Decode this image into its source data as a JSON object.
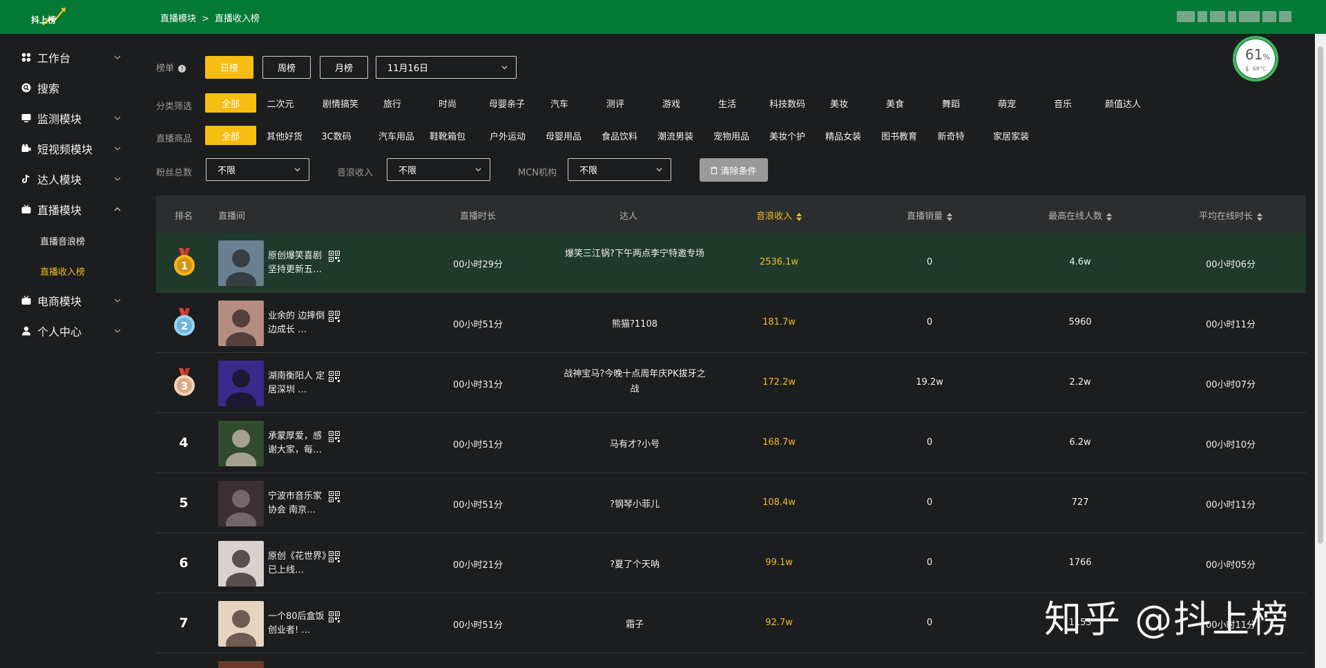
{
  "header": {
    "logo_text": "抖上榜",
    "breadcrumb": [
      "直播模块",
      "直播收入榜"
    ],
    "breadcrumb_sep": ">"
  },
  "sidebar": {
    "items": [
      {
        "label": "工作台",
        "icon": "grid-icon",
        "has_chevron": true,
        "expanded": false
      },
      {
        "label": "搜索",
        "icon": "search-icon",
        "has_chevron": false
      },
      {
        "label": "监测模块",
        "icon": "monitor-icon",
        "has_chevron": true,
        "expanded": false
      },
      {
        "label": "短视频模块",
        "icon": "video-icon",
        "has_chevron": true,
        "expanded": false
      },
      {
        "label": "达人模块",
        "icon": "tiktok-icon",
        "has_chevron": true,
        "expanded": false
      },
      {
        "label": "直播模块",
        "icon": "live-icon",
        "has_chevron": true,
        "expanded": true
      },
      {
        "label": "电商模块",
        "icon": "cart-icon",
        "has_chevron": true,
        "expanded": false
      },
      {
        "label": "个人中心",
        "icon": "user-icon",
        "has_chevron": true,
        "expanded": false
      }
    ],
    "live_sub": [
      "直播音浪榜",
      "直播收入榜"
    ],
    "active_sub": "直播收入榜"
  },
  "filters": {
    "board_label": "榜单",
    "board_tabs": [
      "日榜",
      "周榜",
      "月榜"
    ],
    "board_active": "日榜",
    "date_value": "11月16日",
    "category_label": "分类筛选",
    "categories": [
      "全部",
      "二次元",
      "剧情搞笑",
      "旅行",
      "时尚",
      "母婴亲子",
      "汽车",
      "测评",
      "游戏",
      "生活",
      "科技数码",
      "美妆",
      "美食",
      "舞蹈",
      "萌宠",
      "音乐",
      "颜值达人"
    ],
    "goods_label": "直播商品",
    "goods": [
      "全部",
      "其他好货",
      "3C数码",
      "汽车用品",
      "鞋靴箱包",
      "户外运动",
      "母婴用品",
      "食品饮料",
      "潮流男装",
      "宠物用品",
      "美妆个护",
      "精品女装",
      "图书教育",
      "新奇特",
      "家居家装"
    ],
    "fans_label": "粉丝总数",
    "fans_value": "不限",
    "income_label": "音浪收入",
    "income_value": "不限",
    "mcn_label": "MCN机构",
    "mcn_value": "不限",
    "clear_label": "清除条件"
  },
  "gauge": {
    "value": "61",
    "unit": "%",
    "temp": "68°C"
  },
  "table": {
    "headers": [
      "排名",
      "直播间",
      "直播时长",
      "达人",
      "音浪收入",
      "直播销量",
      "最高在线人数",
      "平均在线时长"
    ],
    "rows": [
      {
        "rank": "1",
        "room": "原创爆笑喜剧 坚持更新五…",
        "duration": "00小时29分",
        "talent": "爆笑三江锅?下午两点李宁特邀专场",
        "income": "2536.1w",
        "sales": "0",
        "max_online": "4.6w",
        "avg_online": "00小时06分"
      },
      {
        "rank": "2",
        "room": "业余的 边摔倒边成长 …",
        "duration": "00小时51分",
        "talent": "熊猫?1108",
        "income": "181.7w",
        "sales": "0",
        "max_online": "5960",
        "avg_online": "00小时11分"
      },
      {
        "rank": "3",
        "room": "湖南衡阳人 定居深圳 …",
        "duration": "00小时31分",
        "talent": "战神宝马?今晚十点周年庆PK拔牙之战",
        "income": "172.2w",
        "sales": "19.2w",
        "max_online": "2.2w",
        "avg_online": "00小时07分"
      },
      {
        "rank": "4",
        "room": "承蒙厚爱，感谢大家，每…",
        "duration": "00小时51分",
        "talent": "马有才?小号",
        "income": "168.7w",
        "sales": "0",
        "max_online": "6.2w",
        "avg_online": "00小时10分"
      },
      {
        "rank": "5",
        "room": "宁波市音乐家协会 南京…",
        "duration": "00小时51分",
        "talent": "?钢琴小菲儿",
        "income": "108.4w",
        "sales": "0",
        "max_online": "727",
        "avg_online": "00小时11分"
      },
      {
        "rank": "6",
        "room": "原创《花世界》已上线…",
        "duration": "00小时21分",
        "talent": "?夏了个天呐",
        "income": "99.1w",
        "sales": "0",
        "max_online": "1766",
        "avg_online": "00小时05分"
      },
      {
        "rank": "7",
        "room": "一个80后盒饭创业者! …",
        "duration": "00小时51分",
        "talent": "霜子",
        "income": "92.7w",
        "sales": "0",
        "max_online": "1153",
        "avg_online": "00小时11分"
      }
    ]
  },
  "watermark": "知乎 @抖上榜",
  "colors": {
    "header_bg": "#057a36",
    "accent": "#f7bd12",
    "page_bg": "#1c1d1e",
    "row_highlight": "#1f3a2b"
  }
}
